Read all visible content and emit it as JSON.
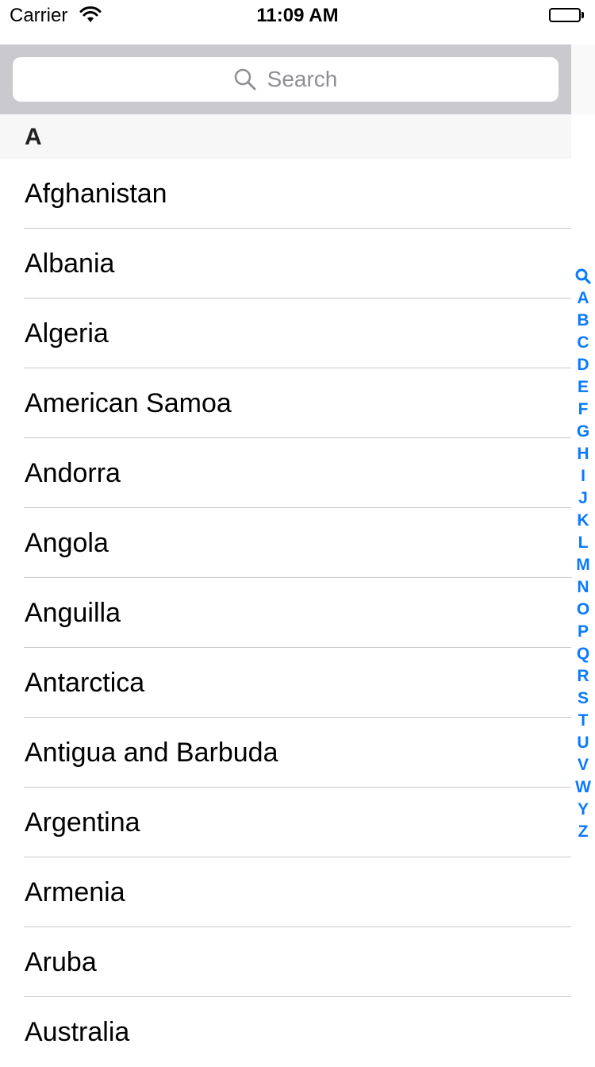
{
  "status_bar": {
    "carrier": "Carrier",
    "time": "11:09 AM",
    "wifi_icon": "wifi-icon",
    "battery_icon": "battery-icon"
  },
  "search": {
    "placeholder": "Search",
    "icon": "search-icon"
  },
  "section": {
    "title": "A"
  },
  "countries": [
    "Afghanistan",
    "Albania",
    "Algeria",
    "American Samoa",
    "Andorra",
    "Angola",
    "Anguilla",
    "Antarctica",
    "Antigua and Barbuda",
    "Argentina",
    "Armenia",
    "Aruba",
    "Australia"
  ],
  "index_bar": {
    "search_icon": "search-icon",
    "letters": [
      "A",
      "B",
      "C",
      "D",
      "E",
      "F",
      "G",
      "H",
      "I",
      "J",
      "K",
      "L",
      "M",
      "N",
      "O",
      "P",
      "Q",
      "R",
      "S",
      "T",
      "U",
      "V",
      "W",
      "Y",
      "Z"
    ]
  },
  "colors": {
    "accent": "#0a7aff",
    "search_bar_bg": "#c9c9ce",
    "section_header_bg": "#f7f7f7",
    "separator": "#c8c7cc",
    "placeholder": "#8e8e93"
  }
}
